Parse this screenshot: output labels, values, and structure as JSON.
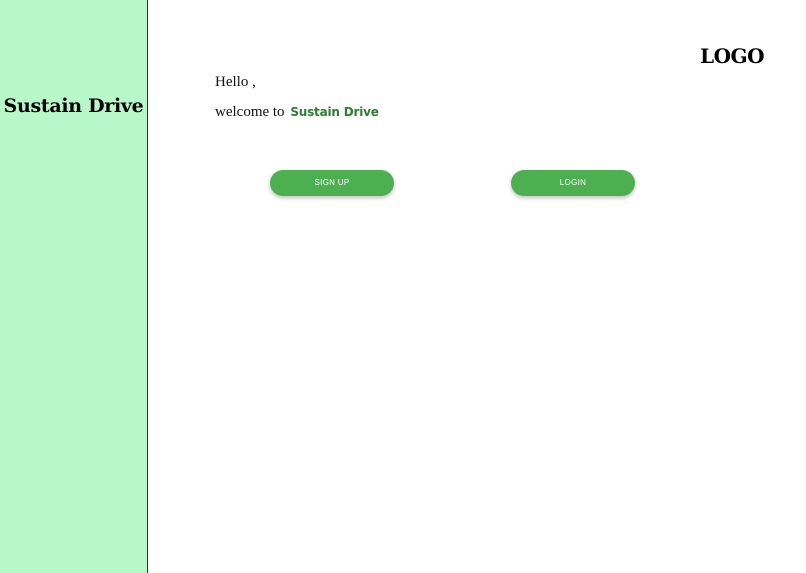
{
  "sidebar": {
    "brand": "Sustain Drive",
    "background": "#b8f8c8"
  },
  "header": {
    "logo": "LOGO"
  },
  "greeting": {
    "hello": "Hello ,",
    "welcome_prefix": "welcome to",
    "app_name": "Sustain Drive",
    "app_name_color": "#2e7d32"
  },
  "actions": {
    "signup_label": "SIGN UP",
    "login_label": "LOGIN",
    "button_color": "#4caf50"
  }
}
